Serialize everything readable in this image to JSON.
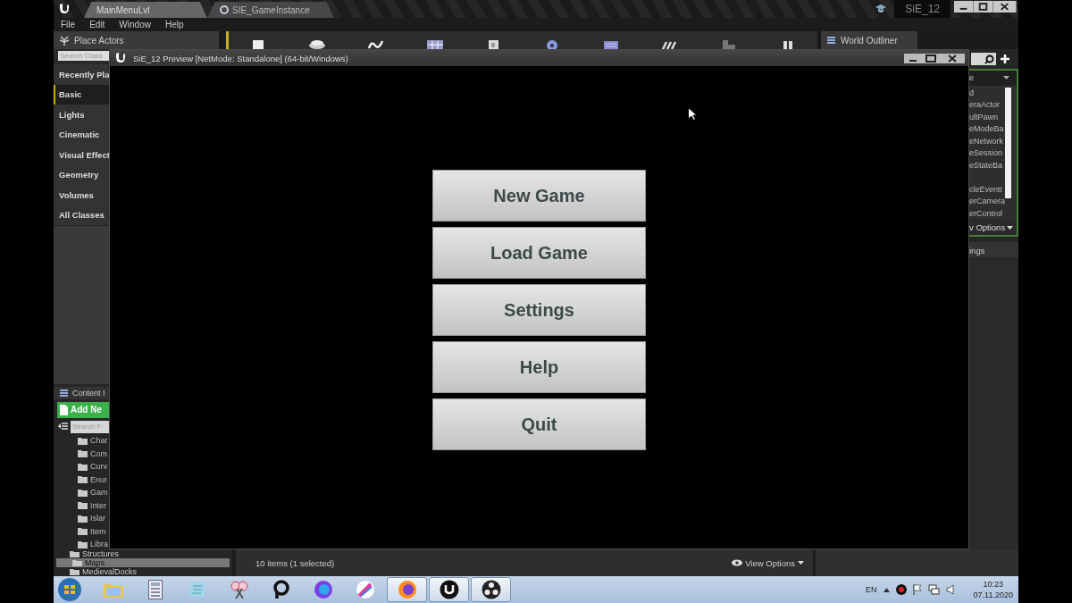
{
  "editor_tabs": [
    {
      "label": "MainMenuLvl",
      "selected": true
    },
    {
      "label": "SIE_GameInstance",
      "selected": false
    }
  ],
  "project_name": "SiE_12",
  "menu": [
    "File",
    "Edit",
    "Window",
    "Help"
  ],
  "place_actors": {
    "tab": "Place Actors",
    "search": {
      "placeholder": "Search Class"
    },
    "categories": [
      {
        "label": "Recently Pla",
        "selected": false
      },
      {
        "label": "Basic",
        "selected": true
      },
      {
        "label": "Lights",
        "selected": false
      },
      {
        "label": "Cinematic",
        "selected": false
      },
      {
        "label": "Visual Effect",
        "selected": false
      },
      {
        "label": "Geometry",
        "selected": false
      },
      {
        "label": "Volumes",
        "selected": false
      },
      {
        "label": "All Classes",
        "selected": false
      }
    ]
  },
  "world_outliner": {
    "tab": "World Outliner",
    "header": "e",
    "item_groups": [
      [
        "d",
        "eraActor",
        "ultPawn",
        "eModeBa",
        "eNetwork",
        "eSession",
        "eStateBa"
      ],
      [
        "cleEventI",
        "erCamera",
        "erControl"
      ]
    ],
    "view_options": "v Options"
  },
  "details": {
    "tab": "ings"
  },
  "content_browser": {
    "tab": "Content I",
    "add_button": "Add Ne",
    "search": {
      "placeholder": "Search F"
    },
    "folders": [
      "Char",
      "Com",
      "Curv",
      "Enur",
      "Gam",
      "Inter",
      "Islar",
      "Item",
      "Libra"
    ],
    "lower_folders": [
      {
        "label": "Structures",
        "selected": false
      },
      {
        "label": "Maps",
        "selected": true
      },
      {
        "label": "MedievalDocks",
        "selected": false
      }
    ],
    "status": "10 items (1 selected)",
    "view_options": "View Options"
  },
  "preview_window": {
    "title": "SiE_12 Preview [NetMode: Standalone] (64-bit/Windows)",
    "buttons": [
      "New Game",
      "Load Game",
      "Settings",
      "Help",
      "Quit"
    ]
  },
  "taskbar": {
    "apps": [
      {
        "kind": "explorer",
        "active": false
      },
      {
        "kind": "calculator",
        "active": false
      },
      {
        "kind": "notepad",
        "active": false
      },
      {
        "kind": "scissors",
        "active": false
      },
      {
        "kind": "ring",
        "active": false
      },
      {
        "kind": "globe-blue",
        "active": false
      },
      {
        "kind": "brush",
        "active": false
      },
      {
        "kind": "globe-orange",
        "active": true
      },
      {
        "kind": "emblem",
        "active": true
      },
      {
        "kind": "aperture",
        "active": true
      }
    ],
    "language": "EN",
    "time": "10:23",
    "date": "07.11.2020"
  }
}
